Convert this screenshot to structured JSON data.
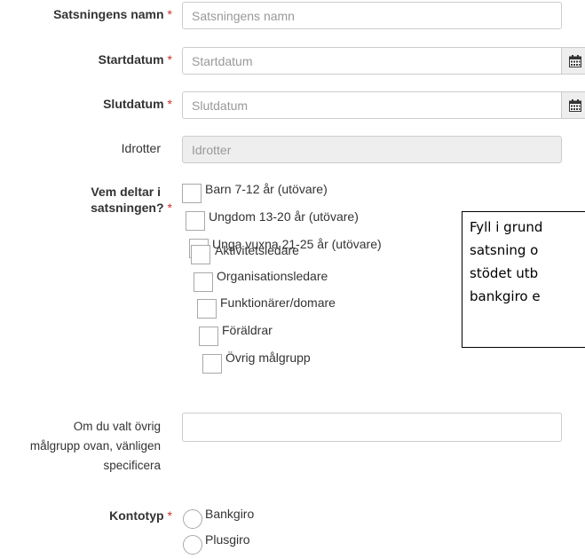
{
  "form": {
    "required_mark": "*",
    "name": {
      "label": "Satsningens namn",
      "placeholder": "Satsningens namn"
    },
    "start": {
      "label": "Startdatum",
      "placeholder": "Startdatum"
    },
    "end": {
      "label": "Slutdatum",
      "placeholder": "Slutdatum"
    },
    "sports": {
      "label": "Idrotter",
      "placeholder": "Idrotter"
    },
    "participants": {
      "label_line1": "Vem deltar i",
      "label_line2": "satsningen?",
      "options": [
        "Barn 7-12 år (utövare)",
        "Ungdom 13-20 år (utövare)",
        "Unga vuxna 21-25 år (utövare)",
        "Aktivitetsledare",
        "Organisationsledare",
        "Funktionärer/domare",
        "Föräldrar",
        "Övrig målgrupp"
      ]
    },
    "other": {
      "label_line1": "Om du valt övrig",
      "label_line2": "målgrupp ovan, vänligen",
      "label_line3": "specificera"
    },
    "account": {
      "label": "Kontotyp",
      "options": [
        "Bankgiro",
        "Plusgiro"
      ]
    }
  },
  "callout": {
    "line1": "Fyll i grund",
    "line2": "satsning o",
    "line3": "stödet utb",
    "line4": "bankgiro e"
  },
  "icons": {
    "calendar": "calendar-icon"
  }
}
